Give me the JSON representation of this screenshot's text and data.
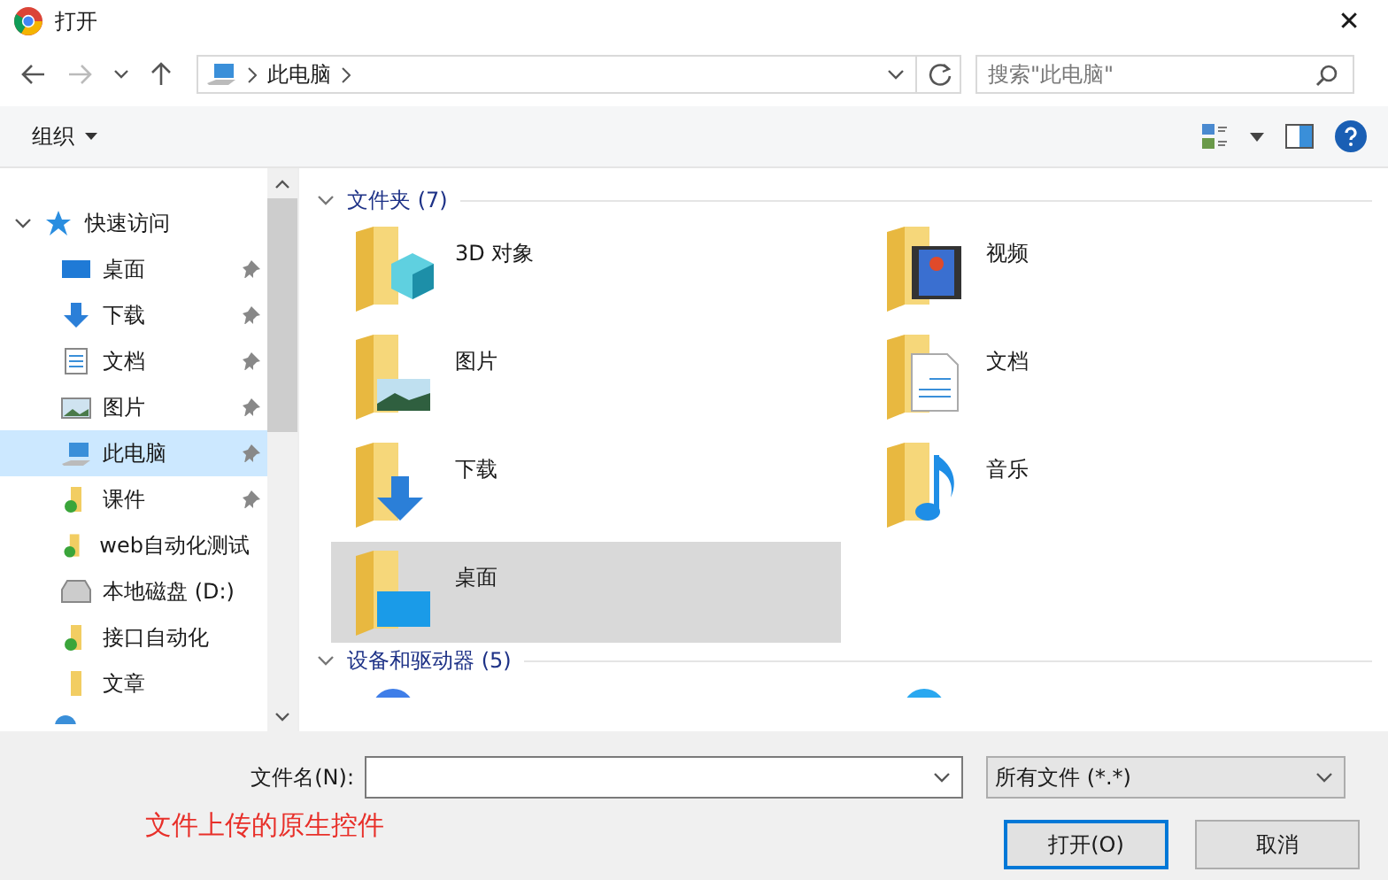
{
  "window": {
    "title": "打开",
    "close": "✕"
  },
  "address": {
    "path": "此电脑",
    "search_placeholder": "搜索\"此电脑\""
  },
  "toolbar": {
    "organize": "组织"
  },
  "sidebar": {
    "header": {
      "label": "快速访问",
      "expanded": true
    },
    "items": [
      {
        "kind": "desktop",
        "label": "桌面",
        "pinned": true,
        "selected": false
      },
      {
        "kind": "download",
        "label": "下载",
        "pinned": true,
        "selected": false
      },
      {
        "kind": "document",
        "label": "文档",
        "pinned": true,
        "selected": false
      },
      {
        "kind": "picture",
        "label": "图片",
        "pinned": true,
        "selected": false
      },
      {
        "kind": "computer",
        "label": "此电脑",
        "pinned": true,
        "selected": true
      },
      {
        "kind": "synced-folder",
        "label": "课件",
        "pinned": true,
        "selected": false
      },
      {
        "kind": "synced-folder",
        "label": "web自动化测试",
        "pinned": false,
        "selected": false
      },
      {
        "kind": "drive",
        "label": "本地磁盘 (D:)",
        "pinned": false,
        "selected": false
      },
      {
        "kind": "synced-folder",
        "label": "接口自动化",
        "pinned": false,
        "selected": false
      },
      {
        "kind": "folder",
        "label": "文章",
        "pinned": false,
        "selected": false
      }
    ]
  },
  "groups": [
    {
      "title": "文件夹 (7)",
      "expanded": true,
      "items": [
        {
          "kind": "cube",
          "label": "3D 对象",
          "selected": false
        },
        {
          "kind": "video",
          "label": "视频",
          "selected": false
        },
        {
          "kind": "picture",
          "label": "图片",
          "selected": false
        },
        {
          "kind": "document",
          "label": "文档",
          "selected": false
        },
        {
          "kind": "download",
          "label": "下载",
          "selected": false
        },
        {
          "kind": "music",
          "label": "音乐",
          "selected": false
        },
        {
          "kind": "desktop",
          "label": "桌面",
          "selected": true
        }
      ]
    },
    {
      "title": "设备和驱动器 (5)",
      "expanded": true
    }
  ],
  "bottom": {
    "filename_label": "文件名(N):",
    "filetype": "所有文件 (*.*)",
    "annotation": "文件上传的原生控件",
    "open_button": "打开(O)",
    "cancel_button": "取消"
  }
}
